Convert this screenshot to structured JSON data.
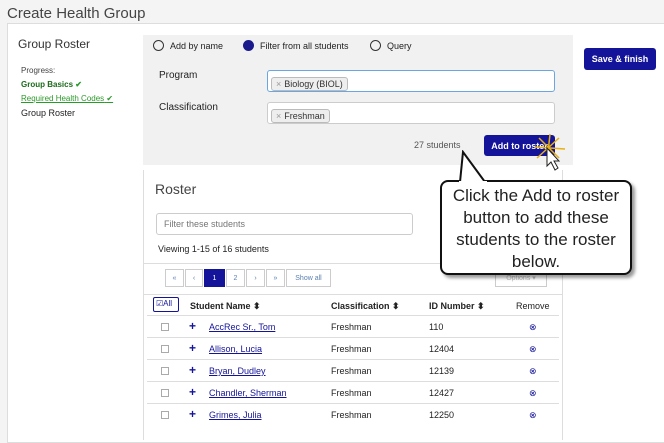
{
  "title": "Create Health Group",
  "sidebar": {
    "heading": "Group Roster",
    "progress_label": "Progress:",
    "steps": [
      {
        "label": "Group Basics"
      },
      {
        "label": "Required Health Codes"
      },
      {
        "label": "Group Roster"
      }
    ]
  },
  "filter": {
    "modes": [
      {
        "label": "Add by name",
        "selected": false
      },
      {
        "label": "Filter from all students",
        "selected": true
      },
      {
        "label": "Query",
        "selected": false
      }
    ],
    "program_label": "Program",
    "program_value": "Biology (BIOL)",
    "classification_label": "Classification",
    "classification_value": "Freshman",
    "count": "27 students",
    "add_button": "Add to roster"
  },
  "save_button": "Save & finish",
  "roster": {
    "heading": "Roster",
    "search_placeholder": "Filter these students",
    "viewing": "Viewing 1-15 of 16 students",
    "pages": [
      "«",
      "‹",
      "1",
      "2",
      "›",
      "»",
      "Show all"
    ],
    "options": "Options ▾",
    "all_label": "All",
    "columns": [
      "Student Name",
      "Classification",
      "ID Number",
      "Remove"
    ],
    "rows": [
      {
        "name": "AccRec Sr., Tom",
        "class": "Freshman",
        "id": "110"
      },
      {
        "name": "Allison, Lucia",
        "class": "Freshman",
        "id": "12404"
      },
      {
        "name": "Bryan, Dudley",
        "class": "Freshman",
        "id": "12139"
      },
      {
        "name": "Chandler, Sherman",
        "class": "Freshman",
        "id": "12427"
      },
      {
        "name": "Grimes, Julia",
        "class": "Freshman",
        "id": "12250"
      }
    ]
  },
  "callout": "Click the Add to roster button to add these students to the roster below."
}
